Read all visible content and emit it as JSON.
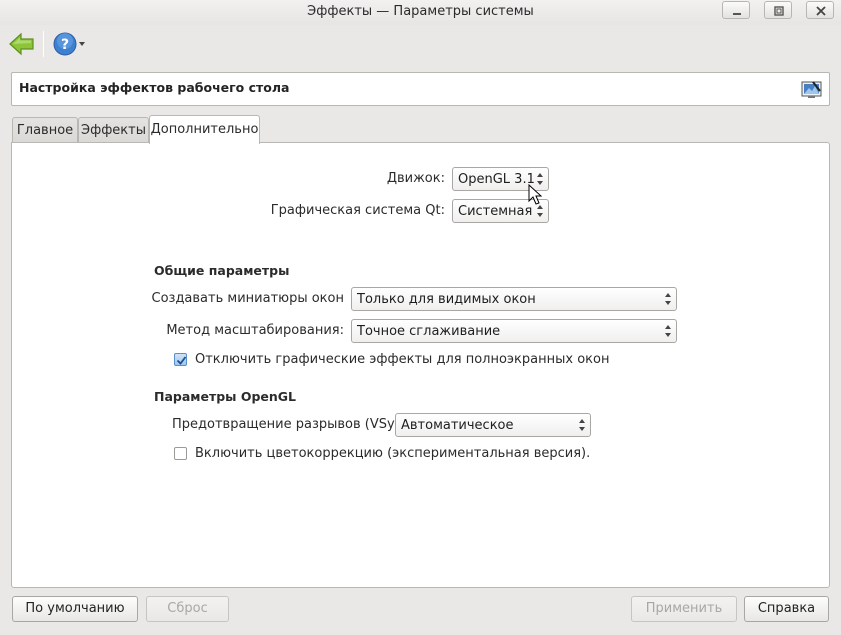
{
  "window": {
    "title": "Эффекты — Параметры системы"
  },
  "header": {
    "title": "Настройка эффектов рабочего стола"
  },
  "tabs": [
    {
      "label": "Главное"
    },
    {
      "label": "Эффекты"
    },
    {
      "label": "Дополнительно"
    }
  ],
  "engine": {
    "label": "Движок:",
    "value": "OpenGL 3.1"
  },
  "qt_graphics": {
    "label": "Графическая система Qt:",
    "value": "Системная"
  },
  "general": {
    "title": "Общие параметры",
    "thumbnails_label": "Создавать миниатюры окон",
    "thumbnails_value": "Только для видимых окон",
    "scale_label": "Метод масштабирования:",
    "scale_value": "Точное сглаживание",
    "fullscreen_label": "Отключить графические эффекты для полноэкранных окон",
    "fullscreen_checked": true
  },
  "opengl": {
    "title": "Параметры OpenGL",
    "vsync_label": "Предотвращение разрывов (VSync)",
    "vsync_value": "Автоматическое",
    "color_label": "Включить цветокоррекцию (экспериментальная версия).",
    "color_checked": false
  },
  "buttons": {
    "defaults": "По умолчанию",
    "reset": "Сброс",
    "apply": "Применить",
    "help": "Справка"
  },
  "icons": {
    "back": "back-arrow-icon",
    "help": "help-icon",
    "header": "desktop-effects-icon"
  },
  "colors": {
    "accent": "#3f7fd0",
    "back_arrow": "#7fb22e"
  }
}
